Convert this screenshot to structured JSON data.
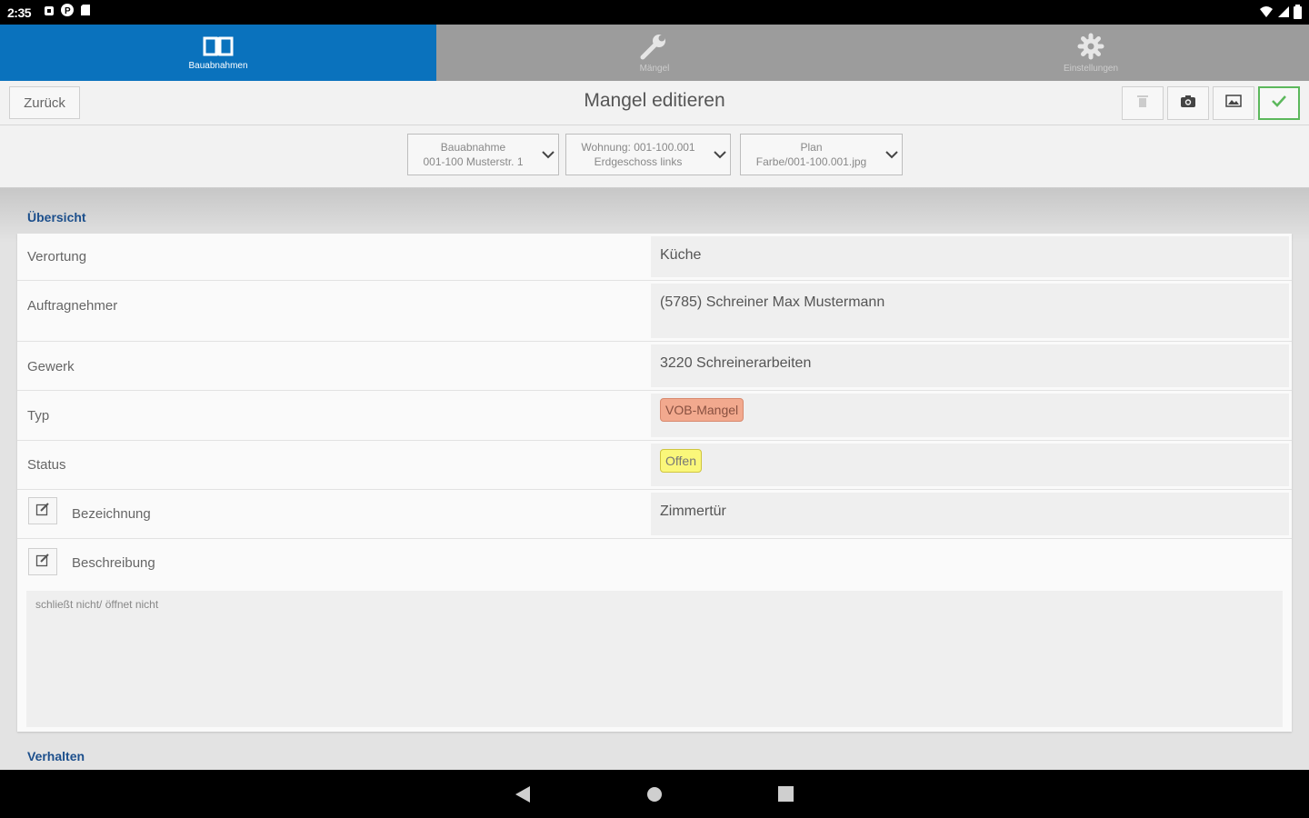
{
  "status_bar": {
    "time": "2:35"
  },
  "tabs": [
    {
      "label": "Bauabnahmen",
      "icon": "book-icon",
      "active": true
    },
    {
      "label": "Mängel",
      "icon": "wrench-icon",
      "active": false
    },
    {
      "label": "Einstellungen",
      "icon": "gear-icon",
      "active": false
    }
  ],
  "toolbar": {
    "back_label": "Zurück",
    "title": "Mangel editieren"
  },
  "filters": [
    {
      "line1": "Bauabnahme",
      "line2": "001-100 Musterstr. 1"
    },
    {
      "line1": "Wohnung: 001-100.001",
      "line2": "Erdgeschoss links"
    },
    {
      "line1": "Plan",
      "line2": "Farbe/001-100.001.jpg"
    }
  ],
  "overview": {
    "heading": "Übersicht",
    "rows": {
      "verortung": {
        "label": "Verortung",
        "value": "Küche"
      },
      "auftragnehmer": {
        "label": "Auftragnehmer",
        "value": "(5785) Schreiner Max Mustermann"
      },
      "gewerk": {
        "label": "Gewerk",
        "value": "3220 Schreinerarbeiten"
      },
      "typ": {
        "label": "Typ",
        "value": "VOB-Mangel",
        "color": "#f2a98e"
      },
      "status": {
        "label": "Status",
        "value": "Offen",
        "color": "#faf77a"
      },
      "bezeichnung": {
        "label": "Bezeichnung",
        "value": "Zimmertür"
      },
      "beschreibung": {
        "label": "Beschreibung",
        "value": "schließt nicht/ öffnet nicht"
      }
    }
  },
  "next_section": {
    "heading": "Verhalten"
  },
  "colors": {
    "primary": "#0a72bd",
    "heading": "#1c4f8c",
    "confirm": "#5cb85c"
  }
}
